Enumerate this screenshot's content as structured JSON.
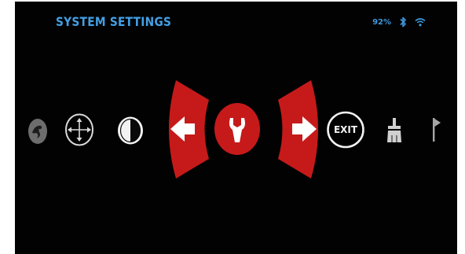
{
  "header": {
    "title": "SYSTEM SETTINGS"
  },
  "status_bar": {
    "battery": "92%",
    "icons": [
      "bluetooth-icon",
      "wifi-icon"
    ],
    "color": "#3f98dc"
  },
  "menu": {
    "items": [
      {
        "name": "reticle-icon",
        "selected": false
      },
      {
        "name": "compass-icon",
        "selected": false
      },
      {
        "name": "contrast-icon",
        "selected": false
      },
      {
        "name": "left-arrow-icon",
        "selected": false
      },
      {
        "name": "wrench-icon",
        "selected": true
      },
      {
        "name": "right-arrow-icon",
        "selected": false
      },
      {
        "name": "exit-icon",
        "label": "EXIT",
        "selected": false
      },
      {
        "name": "clear-brush-icon",
        "selected": false
      },
      {
        "name": "flag-icon",
        "selected": false
      }
    ],
    "accent_color": "#c61a1a"
  }
}
